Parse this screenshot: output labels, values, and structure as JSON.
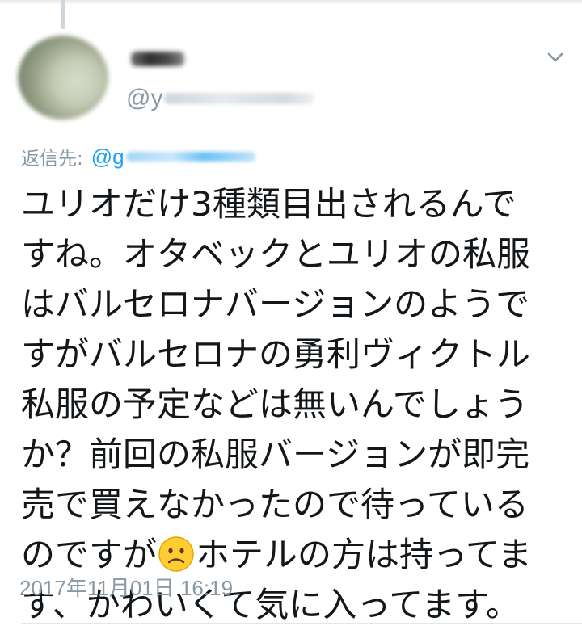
{
  "tweet": {
    "handle_prefix": "@y",
    "reply_label": "返信先:",
    "reply_handle_prefix": "@g",
    "body_lines": [
      "ユリオだけ3種類目出されるんで",
      "すね。オタベックとユリオの私服",
      "はバルセロナバージョンのようで",
      "すがバルセロナの勇利ヴィクトル",
      "私服の予定などは無いんでしょう",
      "か？前回の私服バージョンが即完",
      "売で買えなかったので待っている"
    ],
    "body_line_8_before_emoji": "のですが",
    "body_line_8_after_emoji": "ホテルの方は持ってま",
    "body_line_9": "す、かわいくて気に入ってます。",
    "emoji_icon": "frowning-face-emoji",
    "timestamp": "2017年11月01日 16:19"
  },
  "icons": {
    "menu": "chevron-down-icon"
  },
  "colors": {
    "text": "#14171a",
    "muted": "#8899a6",
    "link": "#1da1f2",
    "divider": "#e1e8ed"
  }
}
